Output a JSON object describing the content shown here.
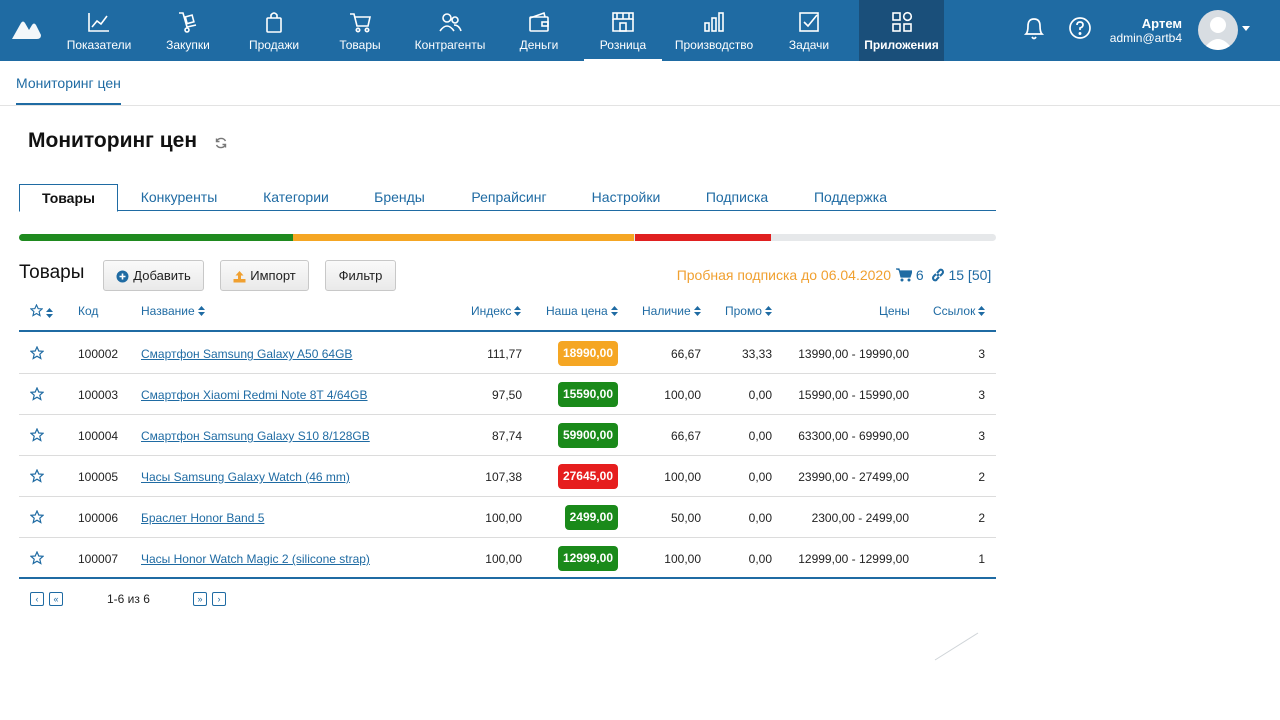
{
  "nav": {
    "items": [
      {
        "label": "Показатели",
        "icon": "chart-line-icon"
      },
      {
        "label": "Закупки",
        "icon": "cart-dolly-icon"
      },
      {
        "label": "Продажи",
        "icon": "shopping-bag-icon"
      },
      {
        "label": "Товары",
        "icon": "cart-icon"
      },
      {
        "label": "Контрагенты",
        "icon": "people-icon"
      },
      {
        "label": "Деньги",
        "icon": "wallet-icon"
      },
      {
        "label": "Розница",
        "icon": "store-icon"
      },
      {
        "label": "Производство",
        "icon": "bar-chart-icon"
      },
      {
        "label": "Задачи",
        "icon": "checkbox-icon"
      },
      {
        "label": "Приложения",
        "icon": "apps-grid-icon"
      }
    ],
    "user_name": "Артем",
    "user_login": "admin@artb4"
  },
  "subnav": {
    "label": "Мониторинг цен"
  },
  "page": {
    "title": "Мониторинг цен"
  },
  "tabs": [
    "Товары",
    "Конкуренты",
    "Категории",
    "Бренды",
    "Репрайсинг",
    "Настройки",
    "Подписка",
    "Поддержка"
  ],
  "progress": {
    "segments": [
      {
        "color": "#1f8a1f",
        "fraction": 0.28
      },
      {
        "color": "#f5a623",
        "fraction": 0.35
      },
      {
        "color": "#e02020",
        "fraction": 0.14
      }
    ]
  },
  "toolbar": {
    "section_title": "Товары",
    "add_label": "Добавить",
    "import_label": "Импорт",
    "filter_label": "Фильтр",
    "trial_text": "Пробная подписка до 06.04.2020",
    "cart_count": "6",
    "link_count": "15 [50]"
  },
  "table": {
    "headers": {
      "code": "Код",
      "name": "Название",
      "index": "Индекс",
      "our_price": "Наша цена",
      "availability": "Наличие",
      "promo": "Промо",
      "prices": "Цены",
      "links": "Ссылок"
    },
    "rows": [
      {
        "code": "100002",
        "name": "Смартфон Samsung Galaxy A50 64GB",
        "index": "111,77",
        "price": "18990,00",
        "price_color": "#f5a623",
        "availability": "66,67",
        "promo": "33,33",
        "prices": "13990,00 - 19990,00",
        "links": "3"
      },
      {
        "code": "100003",
        "name": "Смартфон Xiaomi Redmi Note 8T 4/64GB",
        "index": "97,50",
        "price": "15590,00",
        "price_color": "#1a8a1a",
        "availability": "100,00",
        "promo": "0,00",
        "prices": "15990,00 - 15990,00",
        "links": "3"
      },
      {
        "code": "100004",
        "name": "Смартфон Samsung Galaxy S10 8/128GB",
        "index": "87,74",
        "price": "59900,00",
        "price_color": "#1a8a1a",
        "availability": "66,67",
        "promo": "0,00",
        "prices": "63300,00 - 69990,00",
        "links": "3"
      },
      {
        "code": "100005",
        "name": "Часы Samsung Galaxy Watch (46 mm)",
        "index": "107,38",
        "price": "27645,00",
        "price_color": "#e61e1e",
        "availability": "100,00",
        "promo": "0,00",
        "prices": "23990,00 - 27499,00",
        "links": "2"
      },
      {
        "code": "100006",
        "name": "Браслет Honor Band 5",
        "index": "100,00",
        "price": "2499,00",
        "price_color": "#1a8a1a",
        "availability": "50,00",
        "promo": "0,00",
        "prices": "2300,00 - 2499,00",
        "links": "2"
      },
      {
        "code": "100007",
        "name": "Часы Honor Watch Magic 2 (silicone strap)",
        "index": "100,00",
        "price": "12999,00",
        "price_color": "#1a8a1a",
        "availability": "100,00",
        "promo": "0,00",
        "prices": "12999,00 - 12999,00",
        "links": "1"
      }
    ]
  },
  "pager": {
    "text": "1-6 из 6",
    "prev": "‹",
    "first": "«",
    "last": "»",
    "next": "›"
  }
}
